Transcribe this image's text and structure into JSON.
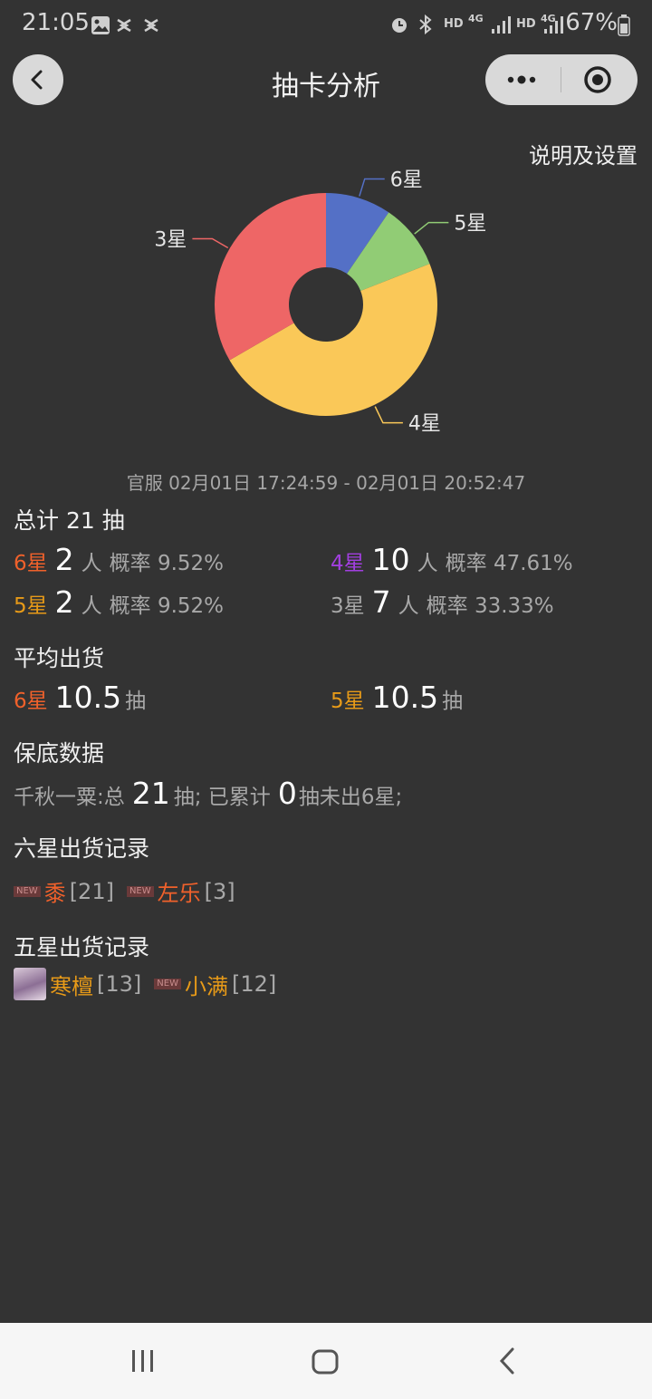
{
  "status_bar": {
    "time": "21:05",
    "network_left": "HD",
    "network_right": "HD",
    "net_gen": "4G",
    "battery": "67%"
  },
  "header": {
    "title": "抽卡分析",
    "more_icon": "more-dots-icon",
    "target_icon": "target-icon"
  },
  "settings_link": "说明及设置",
  "chart_data": {
    "type": "pie",
    "style": "donut",
    "slices": [
      {
        "label": "6星",
        "value": 2,
        "color": "#5470c6"
      },
      {
        "label": "5星",
        "value": 2,
        "color": "#91cc75"
      },
      {
        "label": "4星",
        "value": 10,
        "color": "#fac858"
      },
      {
        "label": "3星",
        "value": 7,
        "color": "#ee6666"
      }
    ]
  },
  "time_range": "官服  02月01日 17:24:59  -  02月01日 20:52:47",
  "summary": {
    "total_label": "总计 21 抽",
    "rows": [
      {
        "star": "6星",
        "count": "2",
        "unit": "人",
        "rate": "概率 9.52%"
      },
      {
        "star": "4星",
        "count": "10",
        "unit": "人",
        "rate": "概率 47.61%"
      },
      {
        "star": "5星",
        "count": "2",
        "unit": "人",
        "rate": "概率 9.52%"
      },
      {
        "star": "3星",
        "count": "7",
        "unit": "人",
        "rate": "概率 33.33%"
      }
    ]
  },
  "average": {
    "title": "平均出货",
    "six": {
      "star": "6星",
      "value": "10.5",
      "unit": "抽"
    },
    "five": {
      "star": "5星",
      "value": "10.5",
      "unit": "抽"
    }
  },
  "pity": {
    "title": "保底数据",
    "pool": "千秋一粟:总",
    "total": "21",
    "mid": "抽;  已累计",
    "accum": "0",
    "tail": "抽未出6星;"
  },
  "six_star_records": {
    "title": "六星出货记录",
    "items": [
      {
        "badge": "NEW",
        "name": "黍",
        "count": "[21]"
      },
      {
        "badge": "NEW",
        "name": "左乐",
        "count": "[3]"
      }
    ]
  },
  "five_star_records": {
    "title": "五星出货记录",
    "items": [
      {
        "name": "寒檀",
        "count": "[13]"
      },
      {
        "badge": "NEW",
        "name": "小满",
        "count": "[12]"
      }
    ]
  }
}
